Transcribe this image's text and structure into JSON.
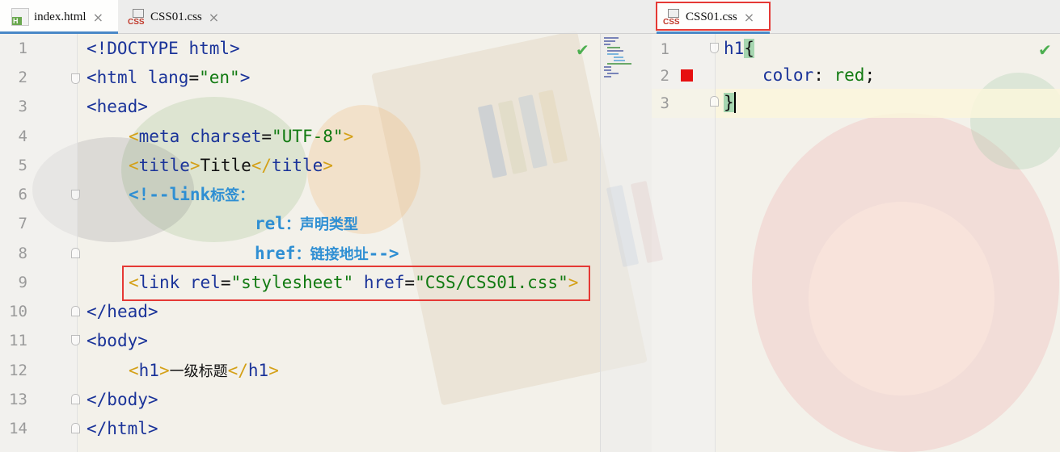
{
  "left_editor": {
    "tabs": [
      {
        "label": "index.html",
        "icon": "html-file-icon",
        "icon_text": "H",
        "active": true
      },
      {
        "label": "CSS01.css",
        "icon": "css-file-icon",
        "icon_text": "CSS",
        "active": false
      }
    ],
    "line_numbers": [
      "1",
      "2",
      "3",
      "4",
      "5",
      "6",
      "7",
      "8",
      "9",
      "10",
      "11",
      "12",
      "13",
      "14"
    ],
    "lines": {
      "l1": {
        "a": "<!DOCTYPE",
        "b": " html",
        "c": ">"
      },
      "l2": {
        "a": "<",
        "b": "html",
        "c": " lang",
        "d": "=",
        "e": "\"en\"",
        "f": ">"
      },
      "l3": {
        "a": "<",
        "b": "head",
        "c": ">"
      },
      "l4": {
        "a": "<",
        "b": "meta",
        "c": " charset",
        "d": "=",
        "e": "\"UTF-8\"",
        "f": ">"
      },
      "l5": {
        "a": "<",
        "b": "title",
        "c": ">",
        "d": "Title",
        "e": "</",
        "f": "title",
        "g": ">"
      },
      "l6": {
        "a": "<!--link",
        "b": "标签："
      },
      "l7": {
        "a": "rel",
        "b": "：声明类型"
      },
      "l8": {
        "a": "href",
        "b": "：链接地址",
        "c": "-->"
      },
      "l9": {
        "a": "<",
        "b": "link",
        "c": " rel",
        "d": "=",
        "e": "\"stylesheet\"",
        "f": " href",
        "g": "=",
        "h": "\"CSS/CSS01.css\"",
        "i": ">"
      },
      "l10": {
        "a": "</",
        "b": "head",
        "c": ">"
      },
      "l11": {
        "a": "<",
        "b": "body",
        "c": ">"
      },
      "l12": {
        "a": "<",
        "b": "h1",
        "c": ">",
        "d": "一级标题",
        "e": "</",
        "f": "h1",
        "g": ">"
      },
      "l13": {
        "a": "</",
        "b": "body",
        "c": ">"
      },
      "l14": {
        "a": "</",
        "b": "html",
        "c": ">"
      }
    },
    "inspection_ok": "✔"
  },
  "right_editor": {
    "tabs": [
      {
        "label": "CSS01.css",
        "icon": "css-file-icon",
        "icon_text": "CSS",
        "active": true
      }
    ],
    "line_numbers": [
      "1",
      "2",
      "3"
    ],
    "lines": {
      "l1": {
        "a": "h1",
        "b": "{"
      },
      "l2": {
        "a": "color",
        "b": ": ",
        "c": "red",
        "d": ";"
      },
      "l3": {
        "a": "}"
      }
    },
    "inspection_ok": "✔",
    "color_swatch": "#e61010"
  },
  "icons": {
    "close": "×",
    "check": "check-icon",
    "fold": "fold-marker-icon"
  },
  "colors": {
    "highlight_box": "#e53935",
    "tag": "#1a3399",
    "string": "#117a11",
    "comment": "#2f8fd3",
    "bracket": "#d4a017"
  }
}
